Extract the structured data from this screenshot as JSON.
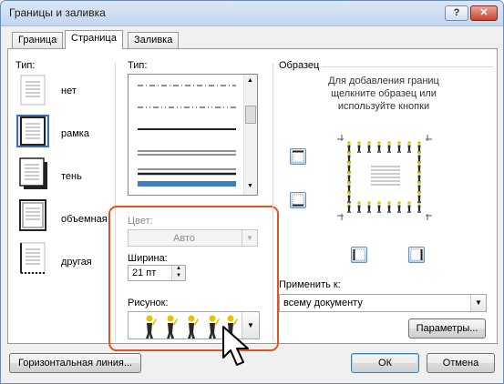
{
  "window": {
    "title": "Границы и заливка",
    "help_label": "?",
    "close_label": "✕"
  },
  "tabs": [
    {
      "label": "Граница"
    },
    {
      "label": "Страница"
    },
    {
      "label": "Заливка"
    }
  ],
  "left": {
    "type_label": "Тип:",
    "presets": [
      {
        "label": "нет"
      },
      {
        "label": "рамка"
      },
      {
        "label": "тень"
      },
      {
        "label": "объемная"
      },
      {
        "label": "другая"
      }
    ]
  },
  "middle": {
    "type_label": "Тип:",
    "color_label": "Цвет:",
    "color_value": "Авто",
    "width_label": "Ширина:",
    "width_value": "21 пт",
    "art_label": "Рисунок:"
  },
  "right": {
    "sample_label": "Образец",
    "sample_hint_1": "Для добавления границ",
    "sample_hint_2": "щелкните образец или",
    "sample_hint_3": "используйте кнопки",
    "apply_label": "Применить к:",
    "apply_value": "всему документу",
    "options_button": "Параметры..."
  },
  "footer": {
    "horizontal_line_button": "Горизонтальная линия...",
    "ok_button": "ОК",
    "cancel_button": "Отмена"
  },
  "colors": {
    "highlight": "#e4531f",
    "selected_line": "#3d7fc0",
    "title_bar": "#c3d6ef"
  }
}
